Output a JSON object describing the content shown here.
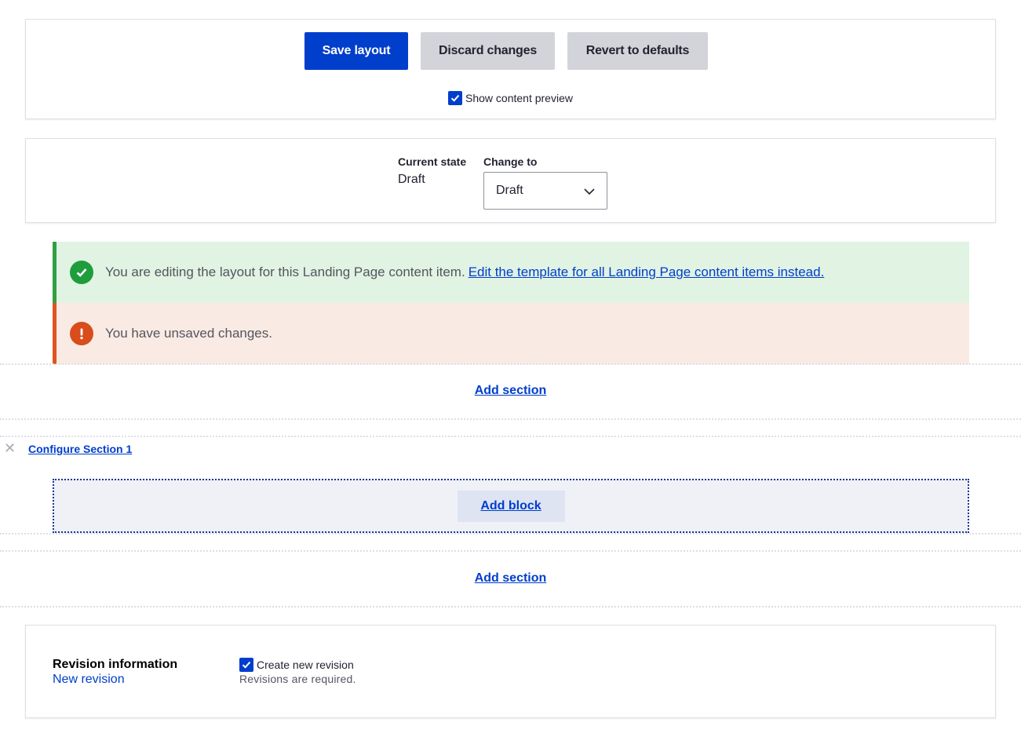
{
  "actions": {
    "save_label": "Save layout",
    "discard_label": "Discard changes",
    "revert_label": "Revert to defaults",
    "preview_label": "Show content preview",
    "preview_checked": true
  },
  "moderation": {
    "current_state_label": "Current state",
    "current_state_value": "Draft",
    "change_to_label": "Change to",
    "change_to_value": "Draft"
  },
  "messages": {
    "status_text": "You are editing the layout for this Landing Page content item.",
    "status_link": "Edit the template for all Landing Page content items instead.",
    "warning_text": "You have unsaved changes."
  },
  "layout": {
    "add_section_label": "Add section",
    "configure_section_label": "Configure Section 1",
    "remove_icon": "close-icon",
    "add_block_label": "Add block"
  },
  "revision": {
    "title": "Revision information",
    "summary": "New revision",
    "checkbox_label": "Create new revision",
    "description": "Revisions are required."
  },
  "colors": {
    "primary": "#003ecc",
    "status_green": "#1f9d3c",
    "warning_orange": "#d84d1b"
  }
}
